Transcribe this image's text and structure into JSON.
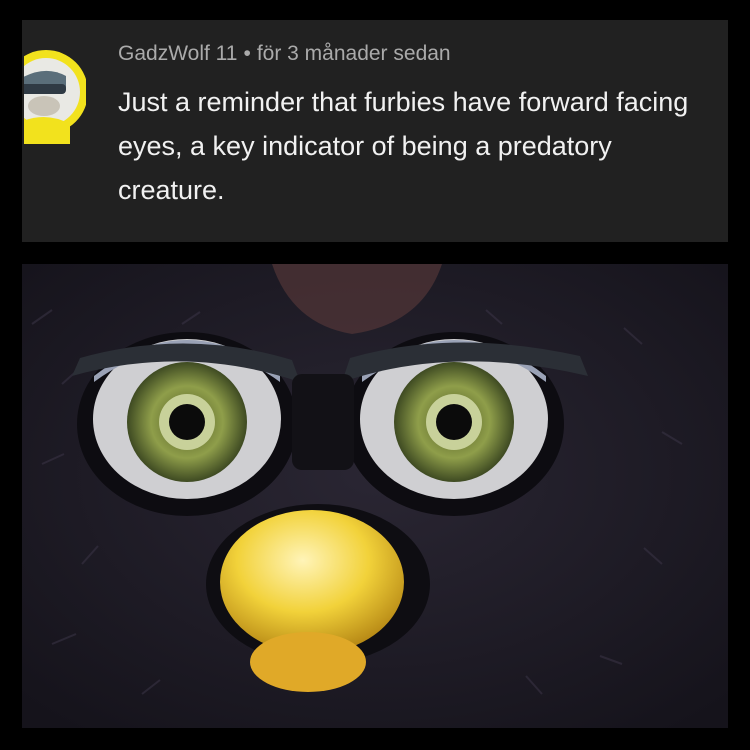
{
  "comment": {
    "username": "GadzWolf 11",
    "separator": "•",
    "timestamp": "för 3 månader sedan",
    "text": "Just a reminder that furbies have forward facing eyes, a key indicator of being a predatory creature."
  },
  "avatar": {
    "icon": "cartoon-avatar-icon",
    "accent": "#f2e21d"
  },
  "photo": {
    "subject": "furby-face-image",
    "fur": "#1e1b26",
    "iris": "#7c8c3a",
    "beak": "#f2d23a"
  }
}
